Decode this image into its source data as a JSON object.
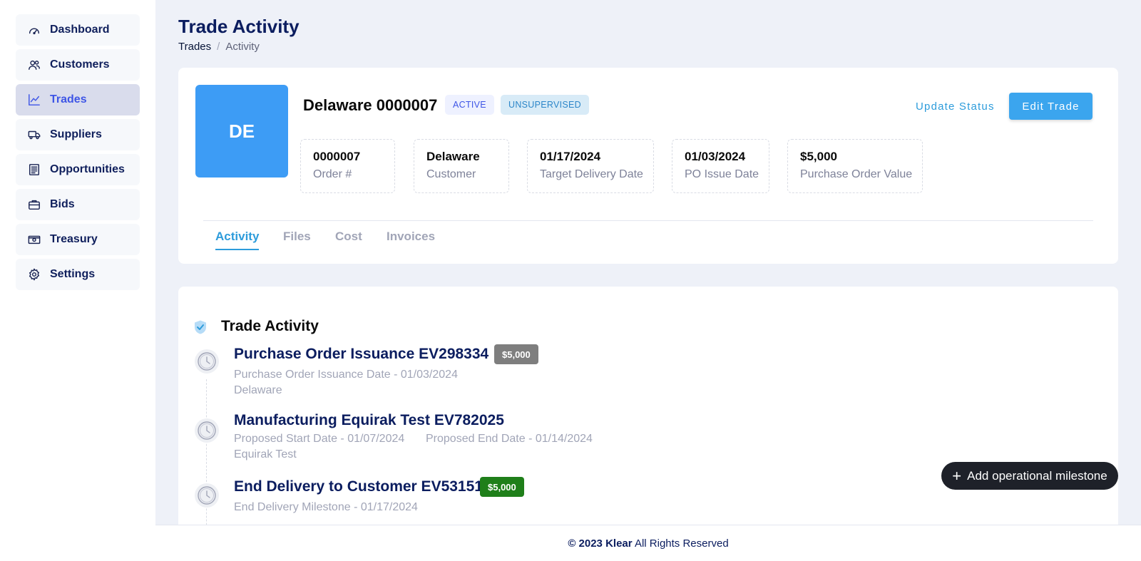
{
  "sidebar": {
    "items": [
      {
        "label": "Dashboard",
        "icon": "gauge-icon"
      },
      {
        "label": "Customers",
        "icon": "users-icon"
      },
      {
        "label": "Trades",
        "icon": "chart-line-icon",
        "active": true
      },
      {
        "label": "Suppliers",
        "icon": "truck-icon"
      },
      {
        "label": "Opportunities",
        "icon": "document-list-icon"
      },
      {
        "label": "Bids",
        "icon": "briefcase-icon"
      },
      {
        "label": "Treasury",
        "icon": "cash-icon"
      },
      {
        "label": "Settings",
        "icon": "gear-icon"
      }
    ]
  },
  "header": {
    "title": "Trade Activity",
    "breadcrumb": [
      "Trades",
      "Activity"
    ],
    "separator": "/"
  },
  "trade": {
    "avatar_initials": "DE",
    "name": "Delaware 0000007",
    "status_badge": "ACTIVE",
    "supervision_badge": "UNSUPERVISED",
    "update_status_label": "Update Status",
    "edit_label": "Edit Trade",
    "stats": [
      {
        "value": "0000007",
        "label": "Order #"
      },
      {
        "value": "Delaware",
        "label": "Customer"
      },
      {
        "value": "01/17/2024",
        "label": "Target Delivery Date"
      },
      {
        "value": "01/03/2024",
        "label": "PO Issue Date"
      },
      {
        "value": "$5,000",
        "label": "Purchase Order Value"
      }
    ],
    "tabs": [
      "Activity",
      "Files",
      "Cost",
      "Invoices"
    ],
    "active_tab": "Activity"
  },
  "activity": {
    "title": "Trade Activity",
    "items": [
      {
        "title": "Purchase Order Issuance EV298334",
        "amount": "$5,000",
        "amount_color": "#7e7e7e",
        "line1": "Purchase Order Issuance Date - 01/03/2024",
        "line2": "Delaware"
      },
      {
        "title": "Manufacturing Equirak Test EV782025",
        "line1": "Proposed Start Date - 01/07/2024",
        "line1b": "Proposed End Date - 01/14/2024",
        "line2": "Equirak Test"
      },
      {
        "title": "End Delivery to Customer EV53151",
        "amount": "$5,000",
        "amount_color": "#1f7f1a",
        "line1": "End Delivery Milestone - 01/17/2024"
      }
    ],
    "add_milestone_label": "Add operational milestone"
  },
  "footer": {
    "copyright": "© 2023",
    "brand": "Klear",
    "rights": "All Rights Reserved"
  },
  "colors": {
    "accent": "#2d9cdb",
    "nav_active": "#3e55e6",
    "avatar": "#3d9cf5"
  }
}
